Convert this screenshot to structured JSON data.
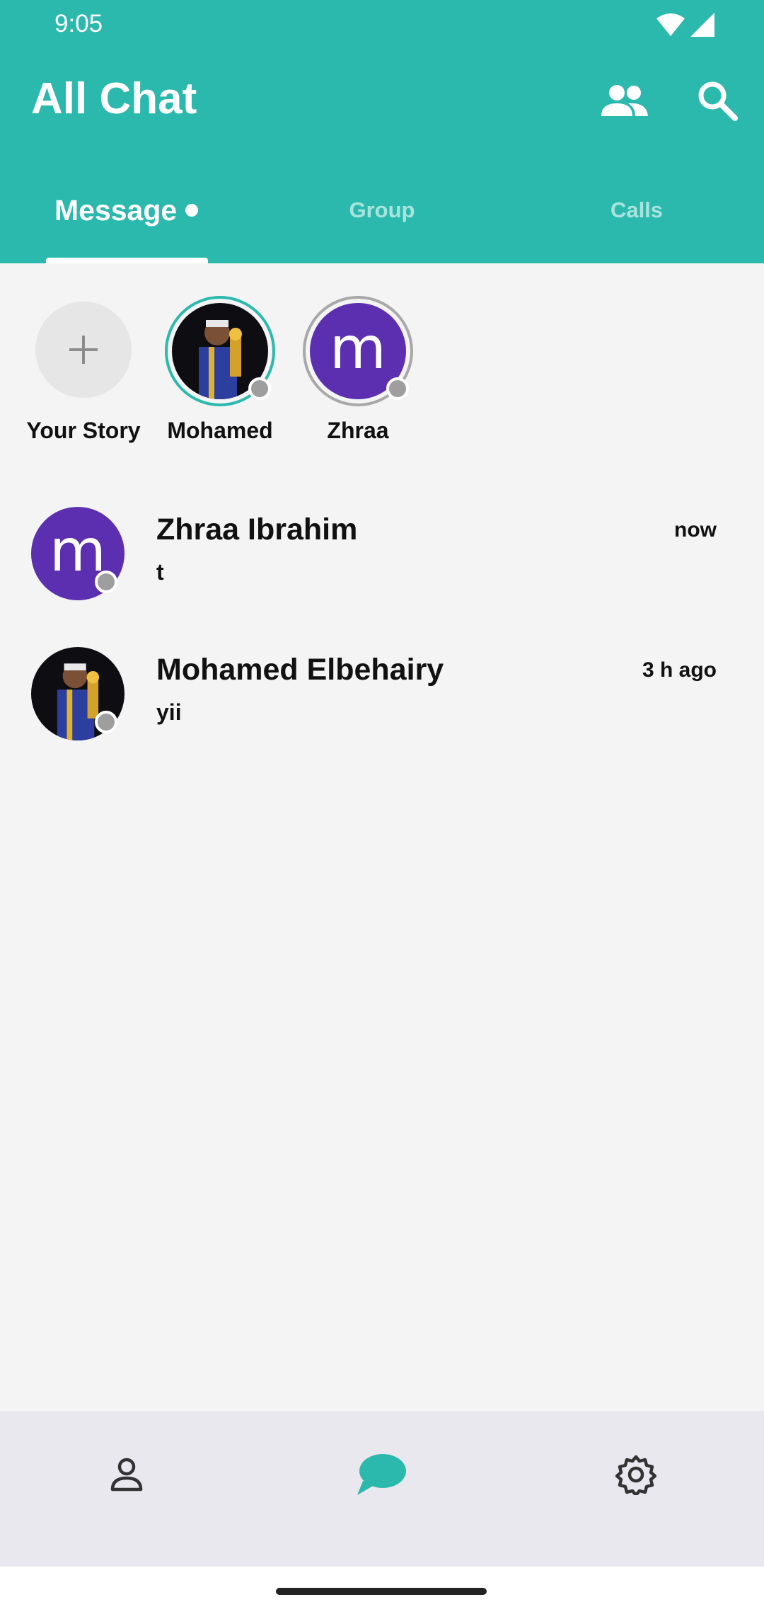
{
  "status_bar": {
    "time": "9:05"
  },
  "header": {
    "title": "All Chat"
  },
  "tabs": [
    {
      "label": "Message",
      "active": true
    },
    {
      "label": "Group",
      "active": false
    },
    {
      "label": "Calls",
      "active": false
    }
  ],
  "stories": {
    "add_label": "Your Story",
    "items": [
      {
        "label": "Mohamed",
        "avatar": "photo"
      },
      {
        "label": "Zhraa",
        "avatar_letter": "m"
      }
    ]
  },
  "chats": [
    {
      "name": "Zhraa Ibrahim",
      "message": "t",
      "time": "now",
      "avatar_letter": "m"
    },
    {
      "name": "Mohamed Elbehairy",
      "message": "yii",
      "time": "3 h ago",
      "avatar": "photo"
    }
  ],
  "colors": {
    "primary": "#2cb9ad",
    "avatar_purple": "#5b2fb0",
    "status_offline": "#9e9e9e"
  },
  "icons": {
    "header": [
      "friends-icon",
      "search-icon"
    ],
    "nav": [
      "profile-icon",
      "chat-bubble-icon",
      "gear-icon"
    ]
  }
}
